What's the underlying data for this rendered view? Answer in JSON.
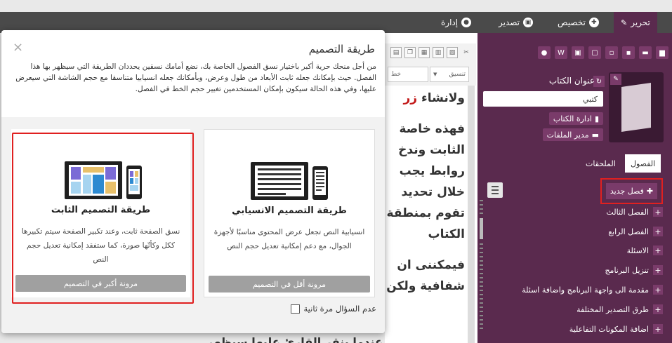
{
  "tabs": [
    {
      "label": "تحرير",
      "icon": "pencil-icon",
      "active": true
    },
    {
      "label": "تخصيص",
      "icon": "wrench-icon"
    },
    {
      "label": "تصدير",
      "icon": "export-icon"
    },
    {
      "label": "إدارة",
      "icon": "user-icon"
    }
  ],
  "sidebar": {
    "book_title_label": "عنوان الكتاب",
    "book_title_value": "كتبي",
    "manage_book": "ادارة الكتاب",
    "file_manager": "مدير الملفات",
    "segment_chapters": "الفصول",
    "segment_attachments": "الملحقات",
    "new_chapter": "فصل جديد",
    "chapters": [
      "الفصل الثالث",
      "الفصل الرابع",
      "الاسئلة",
      "تنزيل البرنامج",
      "مقدمة الى واجهة البرنامج واضافة اسئلة",
      "طرق التصدير المختلفة",
      "اضافة المكونات التفاعلية"
    ]
  },
  "editor": {
    "select_format": "تنسيق",
    "select_font": "خط",
    "text1_a": "ولانشاء",
    "text1_b": "زر",
    "text2": "فهذه خاصة الثابت وندخ روابط يجب خلال تحديد تقوم بمنطقة الكتاب",
    "text3": "فيمكننى ان شفافية ولكن"
  },
  "bottom_text": "عندما ينقر القارئ عليها سيظهر الرسالة له",
  "dialog": {
    "title": "طريقة التصميم",
    "close": "×",
    "description": "من أجل منحك حرية أكبر باختيار نسق الفصول الخاصة بك، نضع أمامك نسقين يحددان الطريقة التي سيظهر بها هذا الفصل. حيث بإمكانك جعله ثابت الأبعاد من طول وعرض، وبأمكانك جعله انسيابيا متناسقا مع حجم الشاشة التي سيعرض عليها، وفي هذه الحالة سيكون بإمكان المستخدمين تغيير حجم الخط في الفصل.",
    "responsive": {
      "title": "طريقة التصميم الانسيابي",
      "desc": "انسيابية النص تجعل عرض المحتوى مناسبًا لأجهزة الجوال، مع دعم إمكانية تعديل حجم النص",
      "button": "مرونة أقل في التصميم"
    },
    "fixed": {
      "title": "طريقة التصميم الثابت",
      "desc": "نسق الصفحة ثابت، وعند تكبير الصفحة سيتم تكبيرها ككل وكأنّها صورة، كما ستفقد إمكانية تعديل حجم النص",
      "button": "مرونة أكبر في التصميم"
    },
    "dont_ask": "عدم السؤال مرة ثانية"
  }
}
